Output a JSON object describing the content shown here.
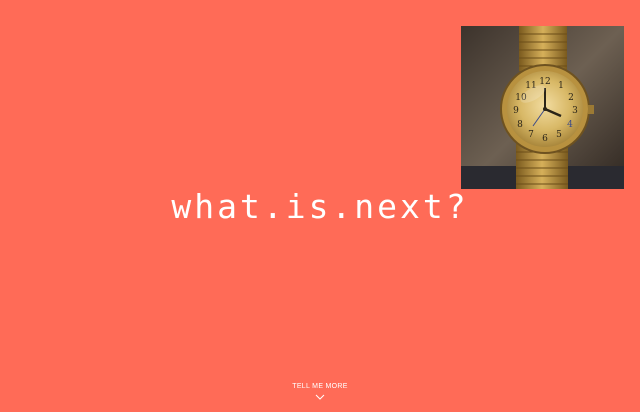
{
  "hero": {
    "headline": "what.is.next?",
    "background_color": "#ff6b57",
    "photo": {
      "subject": "gold wristwatch on wrist",
      "dial_numbers": [
        "12",
        "1",
        "2",
        "3",
        "4",
        "5",
        "6",
        "7",
        "8",
        "9",
        "10",
        "11"
      ]
    },
    "cta": {
      "label": "TELL ME MORE",
      "icon": "chevron-down-icon"
    }
  }
}
